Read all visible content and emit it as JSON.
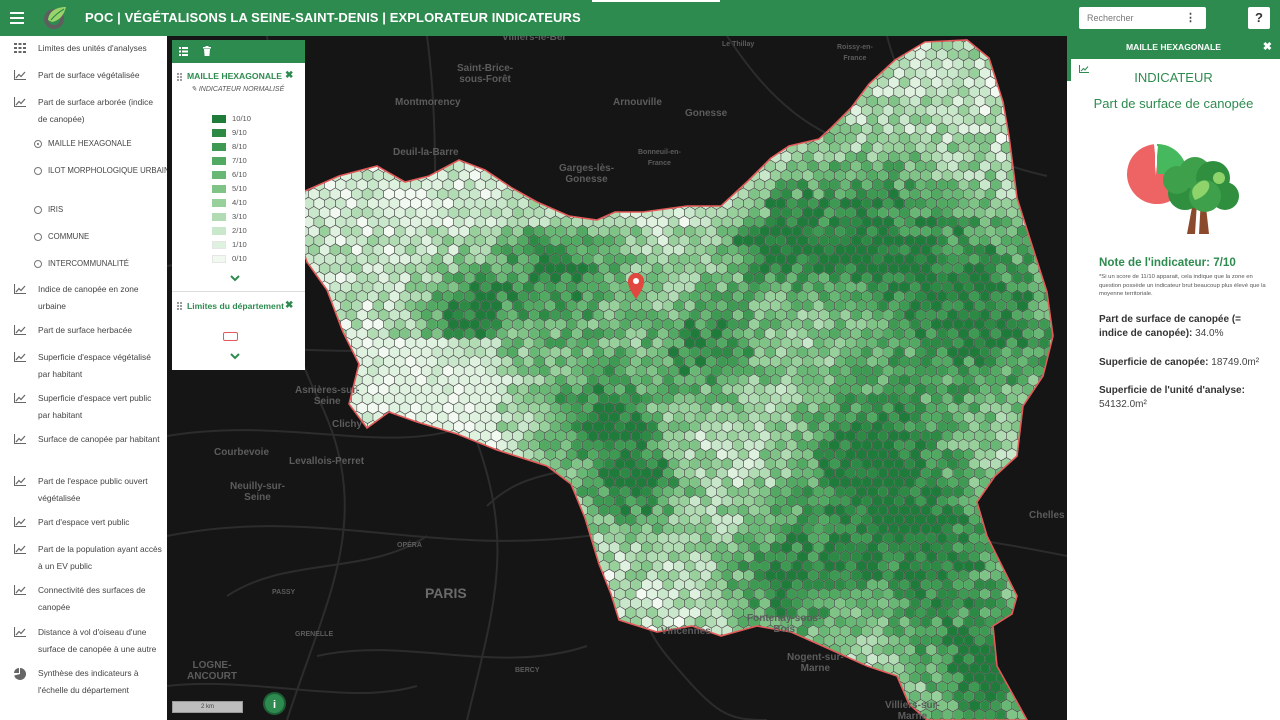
{
  "header": {
    "title": "POC | VÉGÉTALISONS LA SEINE-SAINT-DENIS | EXPLORATEUR INDICATEURS",
    "search_placeholder": "Rechercher",
    "help_label": "?"
  },
  "sidebar": {
    "items": [
      {
        "label": "Limites des unités d'analyses",
        "icon": "grid-icon"
      },
      {
        "label": "Part de surface végétalisée",
        "icon": "chart-line-icon"
      },
      {
        "label": "Part de surface arborée (indice de canopée)",
        "icon": "chart-line-icon"
      },
      {
        "label": "Indice de canopée en zone urbaine",
        "icon": "chart-line-icon"
      },
      {
        "label": "Part de surface herbacée",
        "icon": "chart-line-icon"
      },
      {
        "label": "Superficie d'espace végétalisé par habitant",
        "icon": "chart-line-icon"
      },
      {
        "label": "Superficie d'espace vert public par habitant",
        "icon": "chart-line-icon"
      },
      {
        "label": "Surface de canopée par habitant",
        "icon": "chart-line-icon"
      },
      {
        "label": "Part de l'espace public ouvert végétalisée",
        "icon": "chart-line-icon"
      },
      {
        "label": "Part d'espace vert public",
        "icon": "chart-line-icon"
      },
      {
        "label": "Part de la population ayant accès à un EV public",
        "icon": "chart-line-icon"
      },
      {
        "label": "Connectivité des surfaces de canopée",
        "icon": "chart-line-icon"
      },
      {
        "label": "Distance à vol d'oiseau d'une surface de canopée à une autre",
        "icon": "chart-line-icon"
      },
      {
        "label": "Synthèse des indicateurs à l'échelle du département",
        "icon": "pie-chart-icon"
      }
    ],
    "subitems": [
      {
        "label": "MAILLE HEXAGONALE",
        "selected": true
      },
      {
        "label": "ILOT MORPHOLOGIQUE URBAIN",
        "selected": false
      },
      {
        "label": "IRIS",
        "selected": false
      },
      {
        "label": "COMMUNE",
        "selected": false
      },
      {
        "label": "INTERCOMMUNALITÉ",
        "selected": false
      }
    ]
  },
  "legend": {
    "layer_title": "MAILLE HEXAGONALE",
    "subtitle": "INDICATEUR NORMALISÉ",
    "classes": [
      "10/10",
      "9/10",
      "8/10",
      "7/10",
      "6/10",
      "5/10",
      "4/10",
      "3/10",
      "2/10",
      "1/10",
      "0/10"
    ],
    "class_colors": [
      "#1e7b3a",
      "#2d8a45",
      "#3e9a52",
      "#52aa62",
      "#68b774",
      "#7fc486",
      "#98d09c",
      "#b1dcb3",
      "#c9e7ca",
      "#dff1df",
      "#f1f9f1"
    ],
    "layer2_title": "Limites du département"
  },
  "map": {
    "scale_label": "2 km",
    "info_label": "i",
    "places": [
      {
        "name": "Saint-Brice-\nsous-Forêt",
        "cls": ""
      },
      {
        "name": "Villiers-le-Bel",
        "cls": ""
      },
      {
        "name": "Le Thillay",
        "cls": "small"
      },
      {
        "name": "Roissy-en-\nFrance",
        "cls": "small"
      },
      {
        "name": "Montmorency",
        "cls": ""
      },
      {
        "name": "Arnouville",
        "cls": ""
      },
      {
        "name": "Gonesse",
        "cls": ""
      },
      {
        "name": "Deuil-la-Barre",
        "cls": ""
      },
      {
        "name": "Bonneuil-en-\nFrance",
        "cls": "small"
      },
      {
        "name": "Garges-lès-\nGonesse",
        "cls": ""
      },
      {
        "name": "Asnières-sur-\nSeine",
        "cls": ""
      },
      {
        "name": "Clichy",
        "cls": ""
      },
      {
        "name": "Courbevoie",
        "cls": ""
      },
      {
        "name": "Levallois-Perret",
        "cls": ""
      },
      {
        "name": "Neuilly-sur-\nSeine",
        "cls": ""
      },
      {
        "name": "PARIS",
        "cls": "big"
      },
      {
        "name": "Vincennes",
        "cls": ""
      },
      {
        "name": "Fontenay-sous-\nBois",
        "cls": ""
      },
      {
        "name": "Nogent-sur-\nMarne",
        "cls": ""
      },
      {
        "name": "Chelles",
        "cls": ""
      },
      {
        "name": "Villiers-sur-\nMarne",
        "cls": ""
      },
      {
        "name": "OPÉRA",
        "cls": "small"
      },
      {
        "name": "PASSY",
        "cls": "small"
      },
      {
        "name": "GRENELLE",
        "cls": "small"
      },
      {
        "name": "BERCY",
        "cls": "small"
      },
      {
        "name": "LOGNE-\nANCOURT",
        "cls": ""
      }
    ]
  },
  "panel": {
    "header": "MAILLE HEXAGONALE",
    "close_label": "✖",
    "heading": "INDICATEUR",
    "indicator_name": "Part de surface de canopée",
    "note": "Note de l'indicateur: 7/10",
    "fine_print": "*Si un score de 11/10 apparait, cela indique que la zone en question possède un indicateur brut beaucoup plus élevé que la moyenne territoriale.",
    "stats": [
      {
        "label": "Part de surface de canopée (= indice de canopée):",
        "value": "34.0%"
      },
      {
        "label": "Superficie de canopée:",
        "value": "18749.0m²"
      },
      {
        "label": "Superficie de l'unité d'analyse:",
        "value": "54132.0m²"
      }
    ]
  },
  "colors": {
    "brand": "#2e8b4f",
    "map_background": "#151515",
    "boundary": "#e35a5a",
    "marker": "#e0473f"
  }
}
